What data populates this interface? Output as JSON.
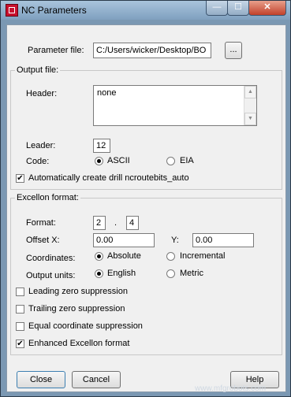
{
  "window": {
    "title": "NC Parameters",
    "controls": {
      "minimize": "—",
      "maximize": "☐",
      "close": "✕"
    }
  },
  "parameter_file": {
    "label": "Parameter file:",
    "value": "C:/Users/wicker/Desktop/BO",
    "browse_label": "..."
  },
  "output_file": {
    "group_label": "Output file:",
    "header_label": "Header:",
    "header_value": "none",
    "leader_label": "Leader:",
    "leader_value": "12",
    "code_label": "Code:",
    "code_options": {
      "ascii": "ASCII",
      "eia": "EIA"
    },
    "code_selected": "ASCII",
    "auto_create_label": "Automatically create drill ncroutebits_auto",
    "auto_create_checked": true
  },
  "excellon": {
    "group_label": "Excellon format:",
    "format_label": "Format:",
    "format_integer": "2",
    "format_separator": ".",
    "format_decimal": "4",
    "offset_x_label": "Offset X:",
    "offset_x_value": "0.00",
    "offset_y_label": "Y:",
    "offset_y_value": "0.00",
    "coordinates_label": "Coordinates:",
    "coordinates_options": {
      "absolute": "Absolute",
      "incremental": "Incremental"
    },
    "coordinates_selected": "Absolute",
    "units_label": "Output units:",
    "units_options": {
      "english": "English",
      "metric": "Metric"
    },
    "units_selected": "English",
    "checks": {
      "leading_zero": {
        "label": "Leading zero suppression",
        "checked": false
      },
      "trailing_zero": {
        "label": "Trailing zero suppression",
        "checked": false
      },
      "equal_coord": {
        "label": "Equal coordinate suppression",
        "checked": false
      },
      "enhanced": {
        "label": "Enhanced Excellon format",
        "checked": true
      }
    }
  },
  "buttons": {
    "close": "Close",
    "cancel": "Cancel",
    "help": "Help"
  },
  "watermark": "www.mfgrobots.com",
  "check_glyph": "✔"
}
